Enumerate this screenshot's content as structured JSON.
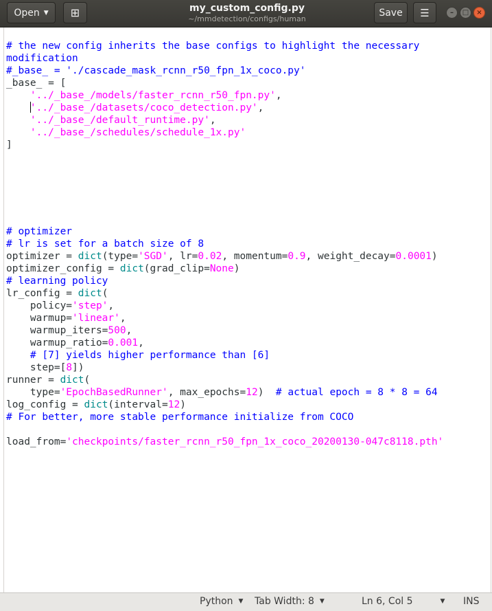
{
  "header": {
    "open_label": "Open",
    "open_caret": "▼",
    "new_doc_glyph": "⊞",
    "title": "my_custom_config.py",
    "subtitle": "~/mmdetection/configs/human",
    "save_label": "Save",
    "menu_glyph": "☰",
    "minimize_glyph": "–",
    "maximize_glyph": "□",
    "close_glyph": "×"
  },
  "editor": {
    "lines": [
      [
        {
          "t": "# the new config inherits the base configs to highlight the necessary",
          "c": "cm"
        }
      ],
      [
        {
          "t": "modification",
          "c": "cm"
        }
      ],
      [
        {
          "t": "#_base_ = './cascade_mask_rcnn_r50_fpn_1x_coco.py'",
          "c": "cm"
        }
      ],
      [
        {
          "t": "_base_ = [",
          "c": ""
        }
      ],
      [
        {
          "t": "    ",
          "c": ""
        },
        {
          "t": "'../_base_/models/faster_rcnn_r50_fpn.py'",
          "c": "st"
        },
        {
          "t": ",",
          "c": ""
        }
      ],
      [
        {
          "t": "    ",
          "c": ""
        },
        {
          "t": "",
          "c": "cursor"
        },
        {
          "t": "'../_base_/datasets/coco_detection.py'",
          "c": "st"
        },
        {
          "t": ",",
          "c": ""
        }
      ],
      [
        {
          "t": "    ",
          "c": ""
        },
        {
          "t": "'../_base_/default_runtime.py'",
          "c": "st"
        },
        {
          "t": ",",
          "c": ""
        }
      ],
      [
        {
          "t": "    ",
          "c": ""
        },
        {
          "t": "'../_base_/schedules/schedule_1x.py'",
          "c": "st"
        }
      ],
      [
        {
          "t": "]",
          "c": ""
        }
      ],
      [],
      [],
      [],
      [],
      [],
      [],
      [
        {
          "t": "# optimizer",
          "c": "cm"
        }
      ],
      [
        {
          "t": "# lr is set for a batch size of 8",
          "c": "cm"
        }
      ],
      [
        {
          "t": "optimizer = ",
          "c": ""
        },
        {
          "t": "dict",
          "c": "bi"
        },
        {
          "t": "(type=",
          "c": ""
        },
        {
          "t": "'SGD'",
          "c": "st"
        },
        {
          "t": ", lr=",
          "c": ""
        },
        {
          "t": "0.02",
          "c": "nm"
        },
        {
          "t": ", momentum=",
          "c": ""
        },
        {
          "t": "0.9",
          "c": "nm"
        },
        {
          "t": ", weight_decay=",
          "c": ""
        },
        {
          "t": "0.0001",
          "c": "nm"
        },
        {
          "t": ")",
          "c": ""
        }
      ],
      [
        {
          "t": "optimizer_config = ",
          "c": ""
        },
        {
          "t": "dict",
          "c": "bi"
        },
        {
          "t": "(grad_clip=",
          "c": ""
        },
        {
          "t": "None",
          "c": "nm"
        },
        {
          "t": ")",
          "c": ""
        }
      ],
      [
        {
          "t": "# learning policy",
          "c": "cm"
        }
      ],
      [
        {
          "t": "lr_config = ",
          "c": ""
        },
        {
          "t": "dict",
          "c": "bi"
        },
        {
          "t": "(",
          "c": ""
        }
      ],
      [
        {
          "t": "    policy=",
          "c": ""
        },
        {
          "t": "'step'",
          "c": "st"
        },
        {
          "t": ",",
          "c": ""
        }
      ],
      [
        {
          "t": "    warmup=",
          "c": ""
        },
        {
          "t": "'linear'",
          "c": "st"
        },
        {
          "t": ",",
          "c": ""
        }
      ],
      [
        {
          "t": "    warmup_iters=",
          "c": ""
        },
        {
          "t": "500",
          "c": "nm"
        },
        {
          "t": ",",
          "c": ""
        }
      ],
      [
        {
          "t": "    warmup_ratio=",
          "c": ""
        },
        {
          "t": "0.001",
          "c": "nm"
        },
        {
          "t": ",",
          "c": ""
        }
      ],
      [
        {
          "t": "    ",
          "c": ""
        },
        {
          "t": "# [7] yields higher performance than [6]",
          "c": "cm"
        }
      ],
      [
        {
          "t": "    step=[",
          "c": ""
        },
        {
          "t": "8",
          "c": "nm"
        },
        {
          "t": "])",
          "c": ""
        }
      ],
      [
        {
          "t": "runner = ",
          "c": ""
        },
        {
          "t": "dict",
          "c": "bi"
        },
        {
          "t": "(",
          "c": ""
        }
      ],
      [
        {
          "t": "    type=",
          "c": ""
        },
        {
          "t": "'EpochBasedRunner'",
          "c": "st"
        },
        {
          "t": ", max_epochs=",
          "c": ""
        },
        {
          "t": "12",
          "c": "nm"
        },
        {
          "t": ")  ",
          "c": ""
        },
        {
          "t": "# actual epoch = 8 * 8 = 64",
          "c": "cm"
        }
      ],
      [
        {
          "t": "log_config = ",
          "c": ""
        },
        {
          "t": "dict",
          "c": "bi"
        },
        {
          "t": "(interval=",
          "c": ""
        },
        {
          "t": "12",
          "c": "nm"
        },
        {
          "t": ")",
          "c": ""
        }
      ],
      [
        {
          "t": "# For better, more stable performance initialize from COCO",
          "c": "cm"
        }
      ],
      [],
      [
        {
          "t": "load_from=",
          "c": ""
        },
        {
          "t": "'checkpoints/faster_rcnn_r50_fpn_1x_coco_20200130-047c8118.pth'",
          "c": "st"
        }
      ]
    ]
  },
  "statusbar": {
    "language": "Python",
    "tab_width": "Tab Width: 8",
    "position": "Ln 6, Col 5",
    "mode": "INS",
    "caret": "▼"
  },
  "colors": {
    "comment": "#0000ff",
    "string": "#ff00ff",
    "number": "#ff00ff",
    "builtin": "#008b8b",
    "headerbar": "#3c3b37",
    "close_button": "#e8643a"
  }
}
